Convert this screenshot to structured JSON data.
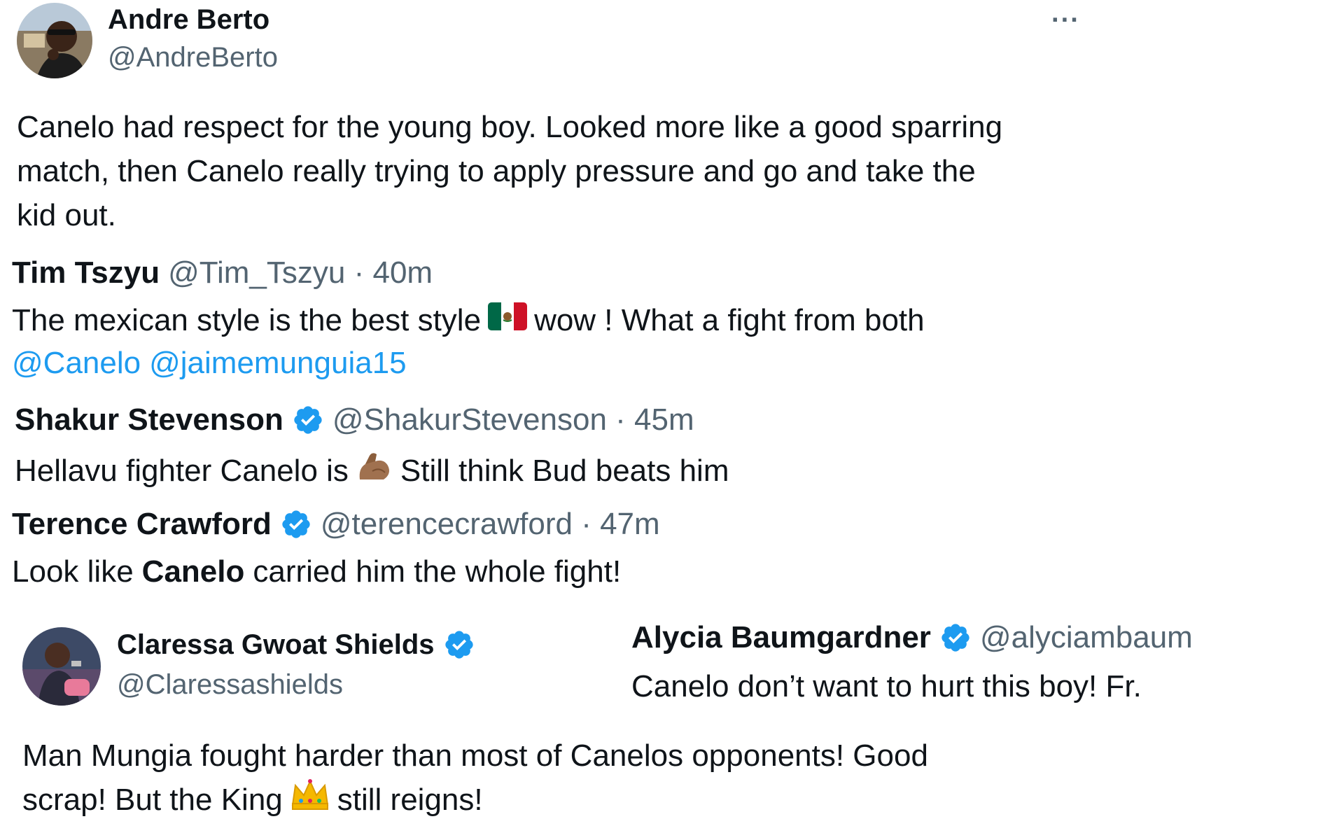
{
  "berto": {
    "name": "Andre Berto",
    "handle": "@AndreBerto",
    "more_glyph": "···",
    "text_line1": "Canelo had respect for the young boy. Looked more like a good sparring",
    "text_line2": "match, then Canelo really trying to apply pressure and go and take the",
    "text_line3": "kid out."
  },
  "tszyu": {
    "name": "Tim Tszyu",
    "handle_time": "@Tim_Tszyu · 40m",
    "text_a": "The mexican style is the best style",
    "text_b": "wow ! What a fight from both",
    "mention1": "@Canelo",
    "mention2": "@jaimemunguia15"
  },
  "stevenson": {
    "name": "Shakur Stevenson",
    "handle_time": "@ShakurStevenson · 45m",
    "text_a": "Hellavu fighter Canelo is",
    "text_b": "Still think Bud beats him"
  },
  "crawford": {
    "name": "Terence Crawford",
    "handle_time": "@terencecrawford · 47m",
    "text_a": "Look like",
    "text_bold": "Canelo",
    "text_b": "carried him the whole fight!"
  },
  "shields": {
    "name": "Claressa Gwoat Shields",
    "handle": "@Claressashields",
    "text_line1": "Man Mungia fought harder than most of Canelos opponents! Good",
    "text_line2a": "scrap! But the King",
    "text_line2b": "still reigns!"
  },
  "baumgardner": {
    "name": "Alycia Baumgardner",
    "handle": "@alyciambaum",
    "text": "Canelo don’t want to hurt this boy! Fr."
  },
  "icons": [
    "avatar-photo",
    "more-icon",
    "verified-badge-icon",
    "mexico-flag-emoji",
    "flexed-biceps-emoji",
    "crown-emoji"
  ],
  "colors": {
    "text": "#0f1419",
    "secondary": "#536471",
    "mention": "#1d9bf0",
    "verified": "#1d9bf0"
  }
}
